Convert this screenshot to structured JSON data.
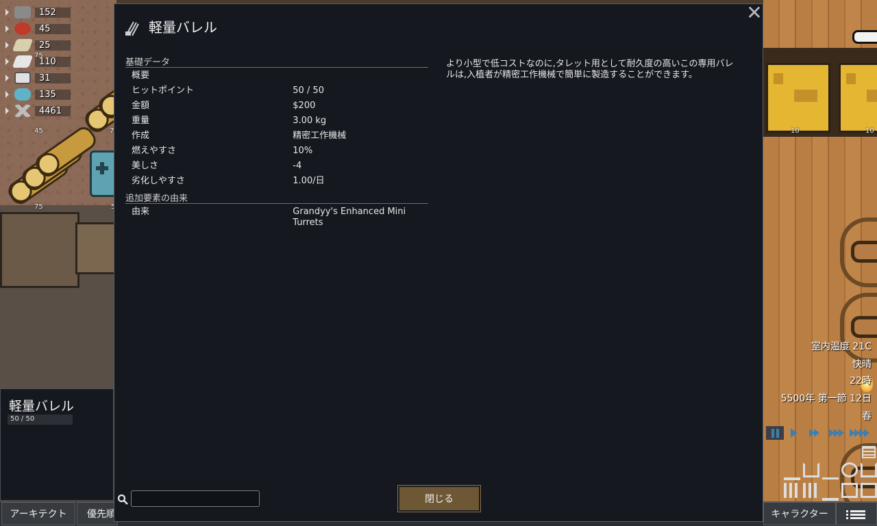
{
  "resources": [
    {
      "value": "152",
      "color": "#9a9a9a"
    },
    {
      "value": "45",
      "color": "#c0392b"
    },
    {
      "value": "25",
      "color": "#d8cfae"
    },
    {
      "value": "110",
      "color": "#e6e6e6"
    },
    {
      "value": "31",
      "color": "#e0e0e0"
    },
    {
      "value": "135",
      "color": "#5fb3c9"
    },
    {
      "value": "4461",
      "color": "#bdbdbd"
    }
  ],
  "world_numbers": {
    "n1": "75",
    "n2": "45",
    "n3": "75",
    "n4": "10",
    "n5": "10",
    "n6": "7",
    "n7": "5"
  },
  "inspect": {
    "title": "軽量バレル",
    "hp": "50 / 50"
  },
  "toolbar": {
    "architect": "アーキテクト",
    "priority": "優先順",
    "characters": "キャラクター"
  },
  "right_info": {
    "temperature": "室内温度 21C",
    "weather": "快晴",
    "time": "22時",
    "date": "5500年 第一節 12日",
    "season": "春"
  },
  "dialog": {
    "title": "軽量バレル",
    "section_base": "基礎データ",
    "stats": [
      {
        "label": "概要",
        "value": ""
      },
      {
        "label": "ヒットポイント",
        "value": "50 / 50"
      },
      {
        "label": "金額",
        "value": "$200"
      },
      {
        "label": "重量",
        "value": "3.00 kg"
      },
      {
        "label": "作成",
        "value": "精密工作機械"
      },
      {
        "label": "燃えやすさ",
        "value": "10%"
      },
      {
        "label": "美しさ",
        "value": "-4"
      },
      {
        "label": "劣化しやすさ",
        "value": "1.00/日"
      }
    ],
    "section_extra": "追加要素の由来",
    "extra": [
      {
        "label": "由来",
        "value": "Grandyy's Enhanced Mini Turrets"
      }
    ],
    "description": "より小型で低コストなのに,タレット用として耐久度の高いこの専用バレルは,入植者が精密工作機械で簡単に製造することができます。",
    "search_placeholder": "",
    "close_label": "閉じる"
  },
  "colors": {
    "panel": "#15191f",
    "button": "#6e5735",
    "accent": "#3c7fb0"
  }
}
